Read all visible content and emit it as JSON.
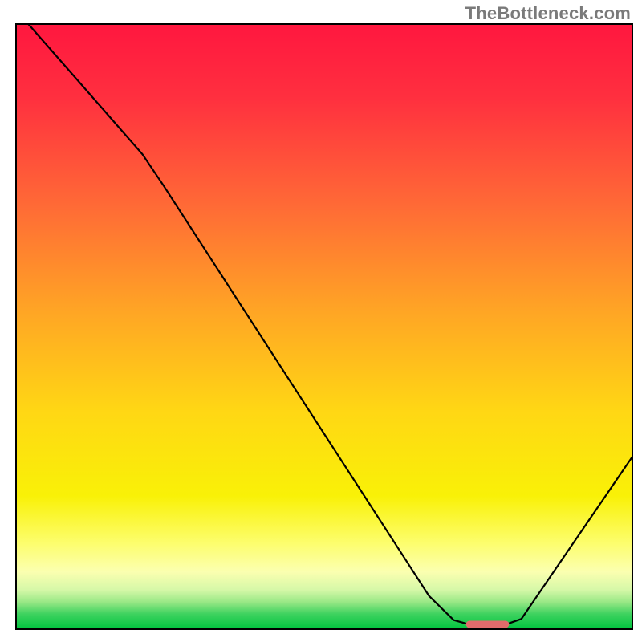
{
  "attribution": "TheBottleneck.com",
  "chart_data": {
    "type": "line",
    "title": "",
    "xlabel": "",
    "ylabel": "",
    "xlim": [
      0,
      100
    ],
    "ylim": [
      0,
      100
    ],
    "axes_visible": false,
    "grid": false,
    "background_gradient": {
      "type": "vertical",
      "stops": [
        {
          "pos": 0.0,
          "color": "#ff173f"
        },
        {
          "pos": 0.12,
          "color": "#ff2f3f"
        },
        {
          "pos": 0.3,
          "color": "#ff6a36"
        },
        {
          "pos": 0.48,
          "color": "#ffa724"
        },
        {
          "pos": 0.64,
          "color": "#ffd714"
        },
        {
          "pos": 0.78,
          "color": "#f9f107"
        },
        {
          "pos": 0.86,
          "color": "#fdfe70"
        },
        {
          "pos": 0.905,
          "color": "#fbffb0"
        },
        {
          "pos": 0.935,
          "color": "#d6f8a8"
        },
        {
          "pos": 0.955,
          "color": "#9ae886"
        },
        {
          "pos": 0.975,
          "color": "#3ed25f"
        },
        {
          "pos": 1.0,
          "color": "#00c43f"
        }
      ]
    },
    "series": [
      {
        "name": "bottleneck-curve",
        "stroke": "#000000",
        "stroke_width": 2.2,
        "points": [
          {
            "x": 2.0,
            "y": 100.0
          },
          {
            "x": 20.5,
            "y": 78.5
          },
          {
            "x": 24.0,
            "y": 73.2
          },
          {
            "x": 67.0,
            "y": 5.5
          },
          {
            "x": 71.0,
            "y": 1.5
          },
          {
            "x": 73.5,
            "y": 0.8
          },
          {
            "x": 79.5,
            "y": 0.8
          },
          {
            "x": 82.0,
            "y": 1.7
          },
          {
            "x": 100.0,
            "y": 28.5
          }
        ]
      }
    ],
    "marker": {
      "name": "optimal-range",
      "shape": "rounded-rect",
      "color": "#e26b6b",
      "x_start": 73.0,
      "x_end": 80.0,
      "y": 0.8,
      "height_frac": 0.012
    }
  }
}
